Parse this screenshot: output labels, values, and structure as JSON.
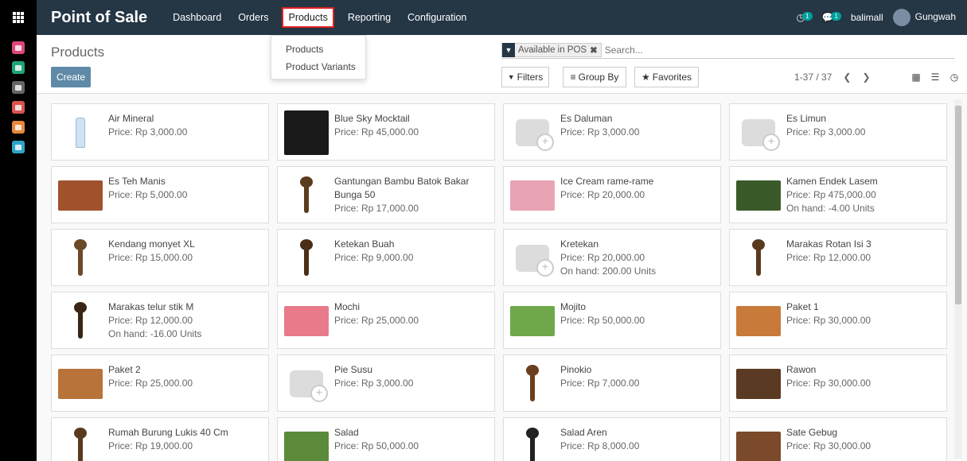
{
  "topbar": {
    "brand": "Point of Sale",
    "menu": [
      "Dashboard",
      "Orders",
      "Products",
      "Reporting",
      "Configuration"
    ],
    "active_menu": "Products",
    "activity_count": "1",
    "message_count": "1",
    "company": "balimall",
    "user": "Gungwah"
  },
  "dropdown": {
    "items": [
      "Products",
      "Product Variants"
    ]
  },
  "control": {
    "breadcrumb": "Products",
    "create_label": "Create",
    "facet_label": "Available in POS",
    "search_placeholder": "Search...",
    "filters_label": "Filters",
    "groupby_label": "Group By",
    "favorites_label": "Favorites",
    "pager": "1-37 / 37"
  },
  "products": [
    {
      "name": "Air Mineral",
      "price": "Price: Rp 3,000.00",
      "onhand": "",
      "img": "bottle",
      "color": "#cfe3f2"
    },
    {
      "name": "Blue Sky Mocktail",
      "price": "Price: Rp 45,000.00",
      "onhand": "",
      "img": "photo",
      "color": "#1a1a1a"
    },
    {
      "name": "Es Daluman",
      "price": "Price: Rp 3,000.00",
      "onhand": "",
      "img": "placeholder",
      "color": ""
    },
    {
      "name": "Es Limun",
      "price": "Price: Rp 3,000.00",
      "onhand": "",
      "img": "placeholder",
      "color": ""
    },
    {
      "name": "Es Teh Manis",
      "price": "Price: Rp 5,000.00",
      "onhand": "",
      "img": "photo",
      "color": "#a0522d"
    },
    {
      "name": "Gantungan Bambu Batok Bakar Bunga 50",
      "price": "Price: Rp 17,000.00",
      "onhand": "",
      "img": "craft",
      "color": "#5a3c1e"
    },
    {
      "name": "Ice Cream rame-rame",
      "price": "Price: Rp 20,000.00",
      "onhand": "",
      "img": "photo",
      "color": "#e8a4b4"
    },
    {
      "name": "Kamen Endek Lasem",
      "price": "Price: Rp 475,000.00",
      "onhand": "On hand: -4.00 Units",
      "img": "photo",
      "color": "#3a5a2a"
    },
    {
      "name": "Kendang monyet XL",
      "price": "Price: Rp 15,000.00",
      "onhand": "",
      "img": "craft",
      "color": "#6b4a2a"
    },
    {
      "name": "Ketekan Buah",
      "price": "Price: Rp 9,000.00",
      "onhand": "",
      "img": "craft",
      "color": "#4a2e18"
    },
    {
      "name": "Kretekan",
      "price": "Price: Rp 20,000.00",
      "onhand": "On hand: 200.00 Units",
      "img": "placeholder",
      "color": ""
    },
    {
      "name": "Marakas Rotan Isi 3",
      "price": "Price: Rp 12,000.00",
      "onhand": "",
      "img": "craft",
      "color": "#5a3a1e"
    },
    {
      "name": "Marakas telur stik M",
      "price": "Price: Rp 12,000.00",
      "onhand": "On hand: -16.00 Units",
      "img": "craft",
      "color": "#3a2614"
    },
    {
      "name": "Mochi",
      "price": "Price: Rp 25,000.00",
      "onhand": "",
      "img": "photo",
      "color": "#e87a8a"
    },
    {
      "name": "Mojito",
      "price": "Price: Rp 50,000.00",
      "onhand": "",
      "img": "photo",
      "color": "#6fa84a"
    },
    {
      "name": "Paket 1",
      "price": "Price: Rp 30,000.00",
      "onhand": "",
      "img": "photo",
      "color": "#c87a3a"
    },
    {
      "name": "Paket 2",
      "price": "Price: Rp 25,000.00",
      "onhand": "",
      "img": "photo",
      "color": "#b8733a"
    },
    {
      "name": "Pie Susu",
      "price": "Price: Rp 3,000.00",
      "onhand": "",
      "img": "placeholder",
      "color": ""
    },
    {
      "name": "Pinokio",
      "price": "Price: Rp 7,000.00",
      "onhand": "",
      "img": "craft",
      "color": "#6a3e1e"
    },
    {
      "name": "Rawon",
      "price": "Price: Rp 30,000.00",
      "onhand": "",
      "img": "photo",
      "color": "#5a3a22"
    },
    {
      "name": "Rumah Burung Lukis 40 Cm",
      "price": "Price: Rp 19,000.00",
      "onhand": "",
      "img": "craft",
      "color": "#5a3a1e"
    },
    {
      "name": "Salad",
      "price": "Price: Rp 50,000.00",
      "onhand": "",
      "img": "photo",
      "color": "#5a8a3a"
    },
    {
      "name": "Salad Aren",
      "price": "Price: Rp 8,000.00",
      "onhand": "",
      "img": "craft",
      "color": "#222222"
    },
    {
      "name": "Sate Gebug",
      "price": "Price: Rp 30,000.00",
      "onhand": "",
      "img": "photo",
      "color": "#7a4a2a"
    }
  ],
  "colors": {
    "topbar": "#253645",
    "accent": "#5f8aa7",
    "badge": "#00a09d"
  }
}
